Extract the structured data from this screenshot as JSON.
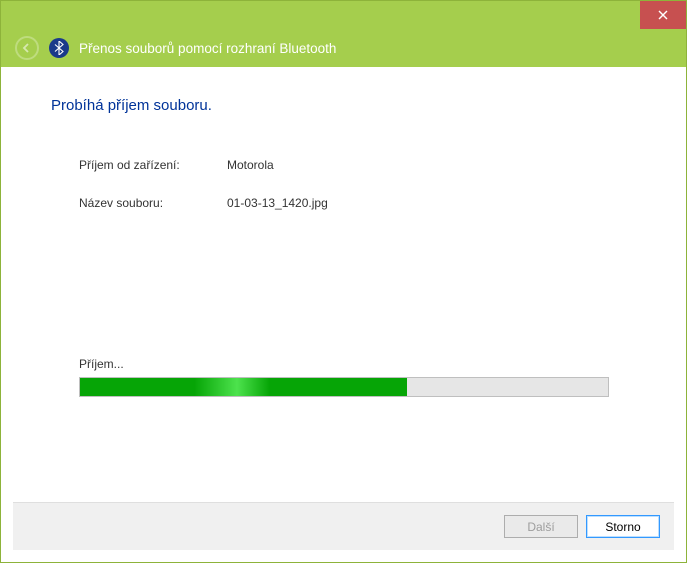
{
  "window": {
    "title": "Přenos souborů pomocí rozhraní Bluetooth"
  },
  "main": {
    "heading": "Probíhá příjem souboru.",
    "device_label": "Příjem od zařízení:",
    "device_value": "Motorola",
    "file_label": "Název souboru:",
    "file_value": "01-03-13_1420.jpg",
    "progress_label": "Příjem...",
    "progress_percent": 62
  },
  "footer": {
    "next_label": "Další",
    "cancel_label": "Storno"
  }
}
